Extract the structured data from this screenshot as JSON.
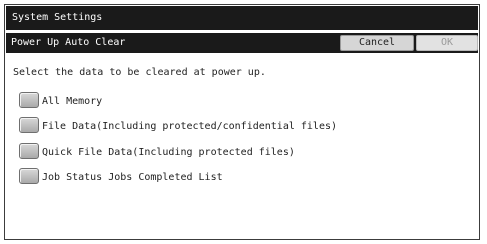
{
  "window": {
    "title": "System Settings"
  },
  "header": {
    "title": "Power Up Auto Clear",
    "cancel_label": "Cancel",
    "ok_label": "OK"
  },
  "instruction": "Select the data to be cleared at power up.",
  "options": [
    {
      "label": "All Memory",
      "checked": false
    },
    {
      "label": "File Data(Including protected/confidential files)",
      "checked": false
    },
    {
      "label": "Quick File Data(Including protected files)",
      "checked": false
    },
    {
      "label": "Job Status Jobs Completed List",
      "checked": false
    }
  ]
}
